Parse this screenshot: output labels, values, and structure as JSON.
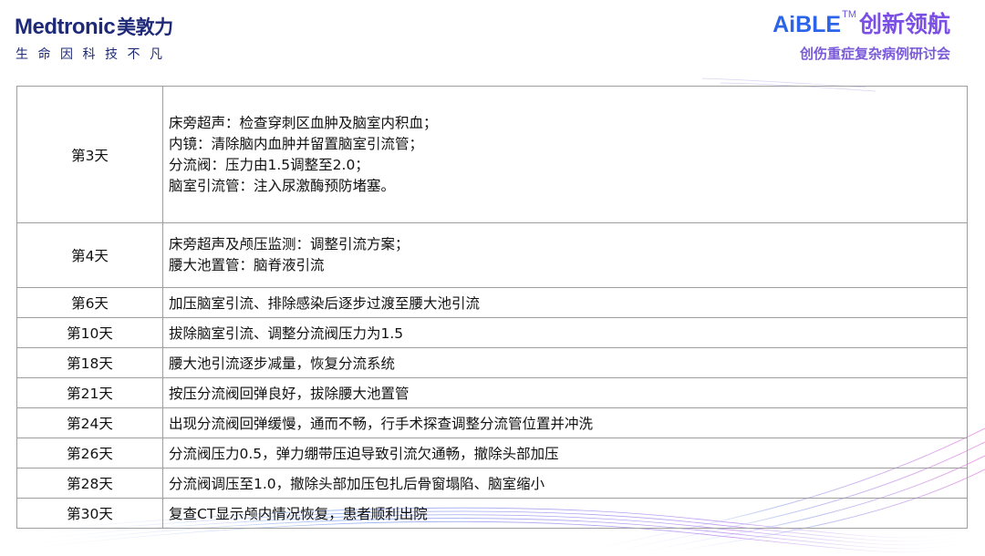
{
  "header": {
    "logo_brand": "Medtronic",
    "logo_cn": "美敦力",
    "logo_tagline": "生命因科技不凡",
    "event_brand": "AiBLE",
    "event_tm": "TM",
    "event_title": "创新领航",
    "event_subtitle": "创伤重症复杂病例研讨会"
  },
  "colors": {
    "logo_navy": "#1e2a78",
    "brand_blue": "#2b64e8",
    "brand_purple": "#7b4fe3",
    "table_border": "#9e9e9e",
    "swoosh_blue": "#3b6fe6",
    "swoosh_purple": "#a05ae8"
  },
  "rows": [
    {
      "day": "第3天",
      "lines": [
        "床旁超声：检查穿刺区血肿及脑室内积血；",
        "内镜：清除脑内血肿并留置脑室引流管；",
        "分流阀：压力由1.5调整至2.0；",
        "脑室引流管：注入尿激酶预防堵塞。"
      ]
    },
    {
      "day": "第4天",
      "lines": [
        "床旁超声及颅压监测：调整引流方案；",
        "腰大池置管：脑脊液引流"
      ]
    },
    {
      "day": "第6天",
      "lines": [
        "加压脑室引流、排除感染后逐步过渡至腰大池引流"
      ]
    },
    {
      "day": "第10天",
      "lines": [
        "拔除脑室引流、调整分流阀压力为1.5"
      ]
    },
    {
      "day": "第18天",
      "lines": [
        "腰大池引流逐步减量，恢复分流系统"
      ]
    },
    {
      "day": "第21天",
      "lines": [
        "按压分流阀回弹良好，拔除腰大池置管"
      ]
    },
    {
      "day": "第24天",
      "lines": [
        "出现分流阀回弹缓慢，通而不畅，行手术探查调整分流管位置并冲洗"
      ]
    },
    {
      "day": "第26天",
      "lines": [
        "分流阀压力0.5，弹力绷带压迫导致引流欠通畅，撤除头部加压"
      ]
    },
    {
      "day": "第28天",
      "lines": [
        "分流阀调压至1.0，撤除头部加压包扎后骨窗塌陷、脑室缩小"
      ]
    },
    {
      "day": "第30天",
      "lines": [
        "复查CT显示颅内情况恢复，患者顺利出院"
      ]
    }
  ]
}
